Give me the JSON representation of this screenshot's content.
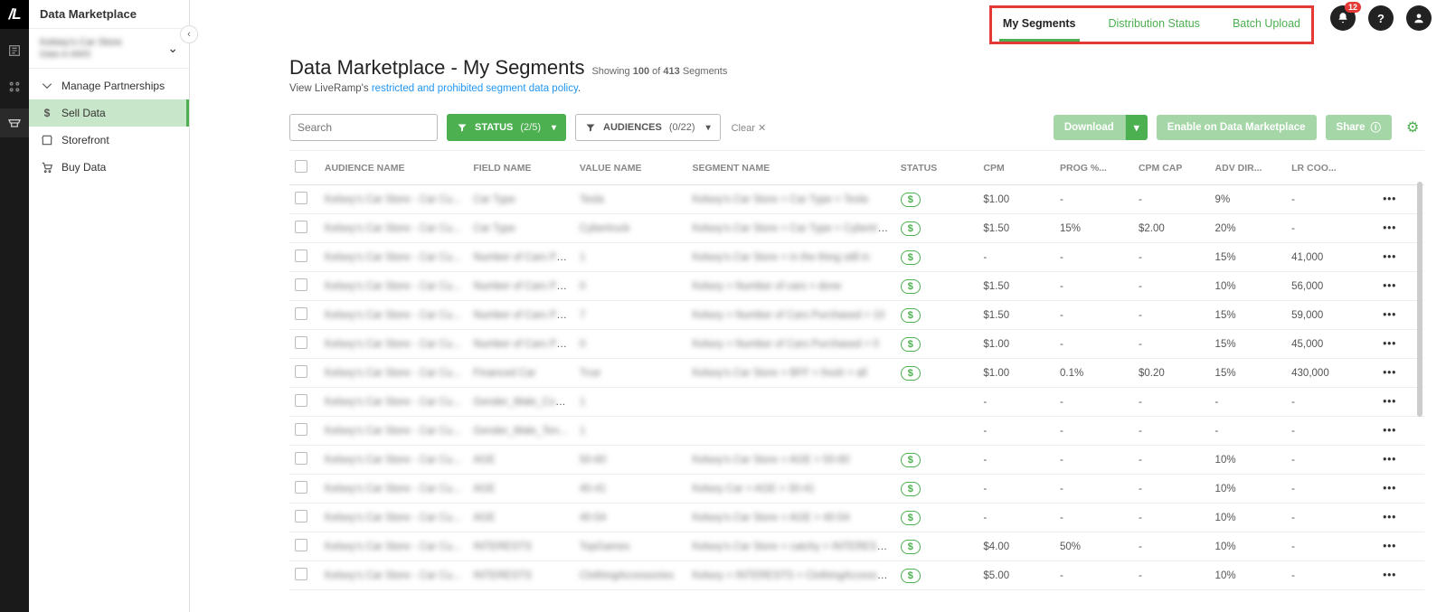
{
  "brand": "/L",
  "appTitle": "Data Marketplace",
  "org": {
    "name": "Kelsey's Car Store",
    "sub": "Data in AWS"
  },
  "notifications": {
    "count": "12"
  },
  "nav": [
    {
      "icon": "handshake",
      "label": "Manage Partnerships"
    },
    {
      "icon": "dollar",
      "label": "Sell Data"
    },
    {
      "icon": "store",
      "label": "Storefront"
    },
    {
      "icon": "cart",
      "label": "Buy Data"
    }
  ],
  "activeNavIndex": 1,
  "tabs": [
    {
      "label": "My Segments",
      "active": true
    },
    {
      "label": "Distribution Status",
      "active": false
    },
    {
      "label": "Batch Upload",
      "active": false
    }
  ],
  "page": {
    "title": "Data Marketplace - My Segments",
    "showing_prefix": "Showing",
    "showing_count": "100",
    "of_word": "of",
    "total_count": "413",
    "suffix": "Segments",
    "policy_prefix": "View LiveRamp's",
    "policy_link": "restricted and prohibited segment data policy"
  },
  "toolbar": {
    "search_placeholder": "Search",
    "status_label": "STATUS",
    "status_count": "(2/5)",
    "audiences_label": "AUDIENCES",
    "audiences_count": "(0/22)",
    "clear": "Clear",
    "download": "Download",
    "enable": "Enable on Data Marketplace",
    "share": "Share"
  },
  "columns": [
    "",
    "AUDIENCE NAME",
    "FIELD NAME",
    "VALUE NAME",
    "SEGMENT NAME",
    "STATUS",
    "CPM",
    "PROG %...",
    "CPM CAP",
    "ADV DIR...",
    "LR COO...",
    ""
  ],
  "rows": [
    {
      "aud": "Kelsey's Car Store - Car Cu...",
      "fld": "Car Type",
      "val": "Tesla",
      "seg": "Kelsey's Car Store > Car Type > Tesla",
      "status": true,
      "cpm": "$1.00",
      "prog": "-",
      "cap": "-",
      "adv": "9%",
      "lr": "-"
    },
    {
      "aud": "Kelsey's Car Store - Car Cu...",
      "fld": "Car Type",
      "val": "Cybertruck",
      "seg": "Kelsey's Car Store > Car Type > Cybertruck",
      "status": true,
      "cpm": "$1.50",
      "prog": "15%",
      "cap": "$2.00",
      "adv": "20%",
      "lr": "-"
    },
    {
      "aud": "Kelsey's Car Store - Car Cu...",
      "fld": "Number of Cars Pu...",
      "val": "1",
      "seg": "Kelsey's Car Store > in the thing still in",
      "status": true,
      "cpm": "-",
      "prog": "-",
      "cap": "-",
      "adv": "15%",
      "lr": "41,000"
    },
    {
      "aud": "Kelsey's Car Store - Car Cu...",
      "fld": "Number of Cars Pu...",
      "val": "0",
      "seg": "Kelsey > Number of cars > done",
      "status": true,
      "cpm": "$1.50",
      "prog": "-",
      "cap": "-",
      "adv": "10%",
      "lr": "56,000"
    },
    {
      "aud": "Kelsey's Car Store - Car Cu...",
      "fld": "Number of Cars Pu...",
      "val": "7",
      "seg": "Kelsey > Number of Cars Purchased > 10",
      "status": true,
      "cpm": "$1.50",
      "prog": "-",
      "cap": "-",
      "adv": "15%",
      "lr": "59,000"
    },
    {
      "aud": "Kelsey's Car Store - Car Cu...",
      "fld": "Number of Cars Pu...",
      "val": "0",
      "seg": "Kelsey > Number of Cars Purchased > 0",
      "status": true,
      "cpm": "$1.00",
      "prog": "-",
      "cap": "-",
      "adv": "15%",
      "lr": "45,000"
    },
    {
      "aud": "Kelsey's Car Store - Car Cu...",
      "fld": "Financed Car",
      "val": "True",
      "seg": "Kelsey's Car Store > BFF > fresh > all",
      "status": true,
      "cpm": "$1.00",
      "prog": "0.1%",
      "cap": "$0.20",
      "adv": "15%",
      "lr": "430,000"
    },
    {
      "aud": "Kelsey's Car Store - Car Cu...",
      "fld": "Gender_Male_Com...",
      "val": "1",
      "seg": "",
      "status": false,
      "cpm": "-",
      "prog": "-",
      "cap": "-",
      "adv": "-",
      "lr": "-"
    },
    {
      "aud": "Kelsey's Car Store - Car Cu...",
      "fld": "Gender_Male_Ten...",
      "val": "1",
      "seg": "",
      "status": false,
      "cpm": "-",
      "prog": "-",
      "cap": "-",
      "adv": "-",
      "lr": "-"
    },
    {
      "aud": "Kelsey's Car Store - Car Cu...",
      "fld": "AGE",
      "val": "50-60",
      "seg": "Kelsey's Car Store > AGE > 50-60",
      "status": true,
      "cpm": "-",
      "prog": "-",
      "cap": "-",
      "adv": "10%",
      "lr": "-"
    },
    {
      "aud": "Kelsey's Car Store - Car Cu...",
      "fld": "AGE",
      "val": "40-41",
      "seg": "Kelsey Car > AGE > 30-41",
      "status": true,
      "cpm": "-",
      "prog": "-",
      "cap": "-",
      "adv": "10%",
      "lr": "-"
    },
    {
      "aud": "Kelsey's Car Store - Car Cu...",
      "fld": "AGE",
      "val": "40-54",
      "seg": "Kelsey's Car Store > AGE > 40-54",
      "status": true,
      "cpm": "-",
      "prog": "-",
      "cap": "-",
      "adv": "10%",
      "lr": "-"
    },
    {
      "aud": "Kelsey's Car Store - Car Cu...",
      "fld": "INTERESTS",
      "val": "TopGames",
      "seg": "Kelsey's Car Store > catchy > INTERESTS - T...",
      "status": true,
      "cpm": "$4.00",
      "prog": "50%",
      "cap": "-",
      "adv": "10%",
      "lr": "-"
    },
    {
      "aud": "Kelsey's Car Store - Car Cu...",
      "fld": "INTERESTS",
      "val": "ClothingAccessories",
      "seg": "Kelsey > INTERESTS > ClothingAccessories",
      "status": true,
      "cpm": "$5.00",
      "prog": "-",
      "cap": "-",
      "adv": "10%",
      "lr": "-"
    }
  ]
}
